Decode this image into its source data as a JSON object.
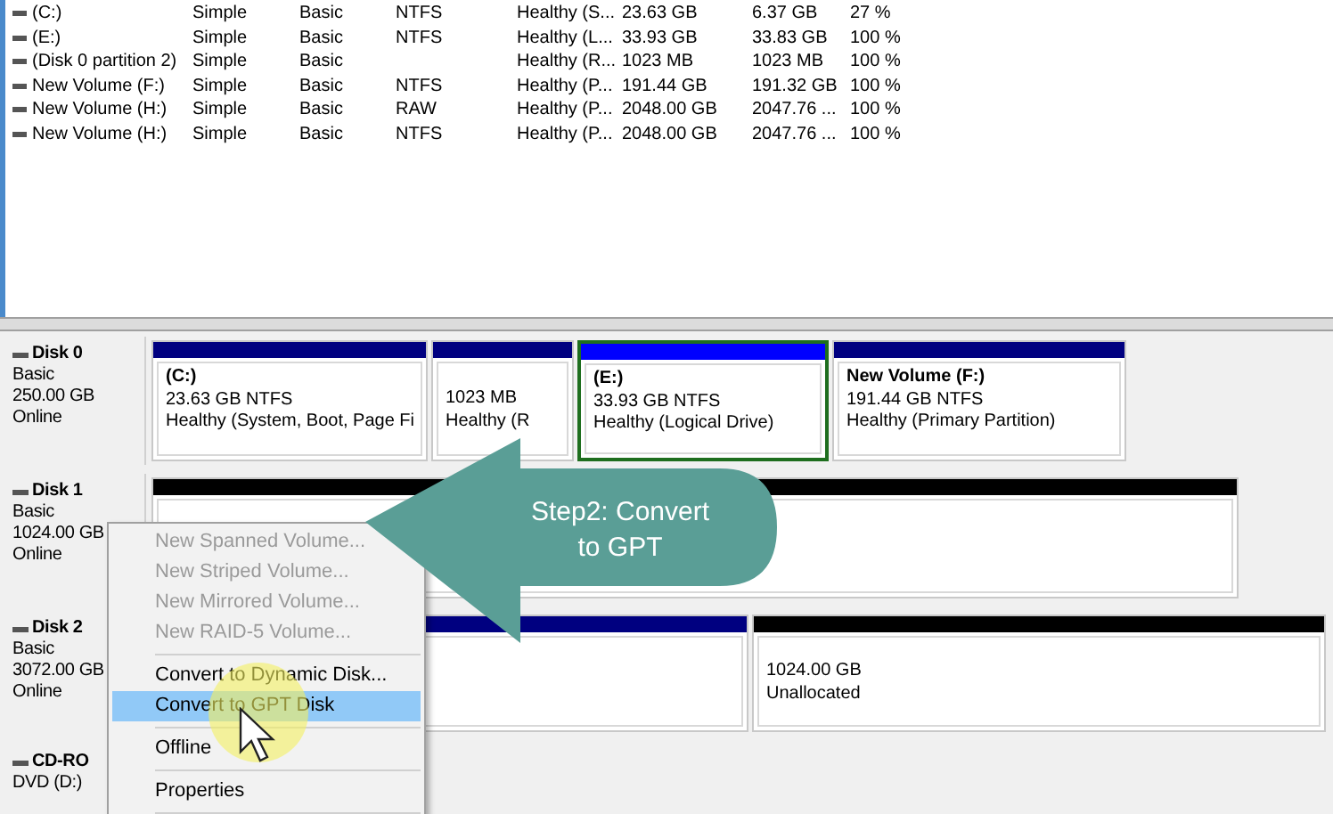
{
  "volumes": [
    {
      "cells": [
        "(C:)",
        "Simple",
        "Basic",
        "NTFS",
        "Healthy (S...",
        "23.63 GB",
        "6.37 GB",
        "27 %"
      ]
    },
    {
      "cells": [
        "(E:)",
        "Simple",
        "Basic",
        "NTFS",
        "Healthy (L...",
        "33.93 GB",
        "33.83 GB",
        "100 %"
      ]
    },
    {
      "cells": [
        "(Disk 0 partition 2)",
        "Simple",
        "Basic",
        "",
        "Healthy (R...",
        "1023 MB",
        "1023 MB",
        "100 %"
      ]
    },
    {
      "cells": [
        "New Volume (F:)",
        "Simple",
        "Basic",
        "NTFS",
        "Healthy (P...",
        "191.44 GB",
        "191.32 GB",
        "100 %"
      ]
    },
    {
      "cells": [
        "New Volume (H:)",
        "Simple",
        "Basic",
        "RAW",
        "Healthy (P...",
        "2048.00 GB",
        "2047.76 ...",
        "100 %"
      ]
    },
    {
      "cells": [
        "New Volume (H:)",
        "Simple",
        "Basic",
        "NTFS",
        "Healthy (P...",
        "2048.00 GB",
        "2047.76 ...",
        "100 %"
      ]
    }
  ],
  "disks": [
    {
      "name": "Disk 0",
      "lines": [
        "Basic",
        "250.00 GB",
        "Online"
      ],
      "partitions": [
        {
          "title": "(C:)",
          "size": "23.63 GB NTFS",
          "status": "Healthy (System, Boot, Page Fi",
          "color": "#000080",
          "selected": false
        },
        {
          "size": "1023 MB",
          "status": "Healthy (R",
          "color": "#000080",
          "selected": false
        },
        {
          "title": "(E:)",
          "size": "33.93 GB NTFS",
          "status": "Healthy (Logical Drive)",
          "color": "#0000ff",
          "selected": true
        },
        {
          "title": "New Volume  (F:)",
          "size": "191.44 GB NTFS",
          "status": "Healthy (Primary Partition)",
          "color": "#000080",
          "selected": false
        }
      ]
    },
    {
      "name": "Disk 1",
      "lines": [
        "Basic",
        "1024.00 GB",
        "Online"
      ],
      "partitions": [
        {
          "color": "#000000",
          "selected": false
        }
      ]
    },
    {
      "name": "Disk 2",
      "lines": [
        "Basic",
        "3072.00 GB",
        "Online"
      ],
      "partitions": [
        {
          "color": "#000080",
          "selected": false
        },
        {
          "size": "1024.00 GB",
          "status": "Unallocated",
          "color": "#000000",
          "selected": false
        }
      ]
    }
  ],
  "cdrom": {
    "name": "CD-RO",
    "lines": [
      "DVD (D:)"
    ]
  },
  "context_menu": [
    {
      "kind": "item",
      "label": "New Spanned Volume...",
      "disabled": true,
      "selected": false
    },
    {
      "kind": "item",
      "label": "New Striped Volume...",
      "disabled": true,
      "selected": false
    },
    {
      "kind": "item",
      "label": "New Mirrored Volume...",
      "disabled": true,
      "selected": false
    },
    {
      "kind": "item",
      "label": "New RAID-5 Volume...",
      "disabled": true,
      "selected": false
    },
    {
      "kind": "separator"
    },
    {
      "kind": "item",
      "label": "Convert to Dynamic Disk...",
      "disabled": false,
      "selected": false
    },
    {
      "kind": "item",
      "label": "Convert to GPT Disk",
      "disabled": false,
      "selected": true
    },
    {
      "kind": "separator"
    },
    {
      "kind": "item",
      "label": "Offline",
      "disabled": false,
      "selected": false
    },
    {
      "kind": "separator"
    },
    {
      "kind": "item",
      "label": "Properties",
      "disabled": false,
      "selected": false
    },
    {
      "kind": "separator"
    }
  ],
  "callout": {
    "text": "Step2: Convert to GPT"
  }
}
